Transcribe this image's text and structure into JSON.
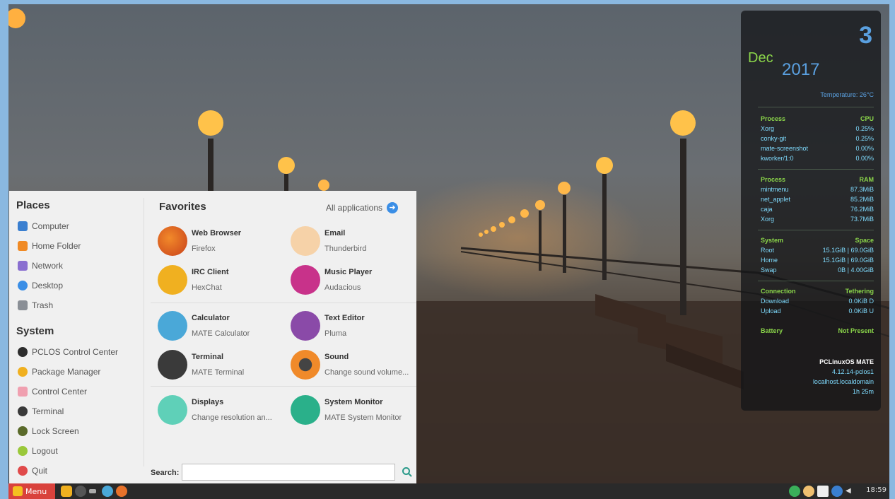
{
  "conky": {
    "day": "3",
    "month": "Dec",
    "year": "2017",
    "temperature": "Temperature: 26°C",
    "cpu": {
      "header_left": "Process",
      "header_right": "CPU",
      "rows": [
        {
          "name": "Xorg",
          "value": "0.25%"
        },
        {
          "name": "conky-git",
          "value": "0.25%"
        },
        {
          "name": "mate-screenshot",
          "value": "0.00%"
        },
        {
          "name": "kworker/1:0",
          "value": "0.00%"
        }
      ]
    },
    "ram": {
      "header_left": "Process",
      "header_right": "RAM",
      "rows": [
        {
          "name": "mintmenu",
          "value": "87.3MiB"
        },
        {
          "name": "net_applet",
          "value": "85.2MiB"
        },
        {
          "name": "caja",
          "value": "76.2MiB"
        },
        {
          "name": "Xorg",
          "value": "73.7MiB"
        }
      ]
    },
    "space": {
      "header_left": "System",
      "header_right": "Space",
      "rows": [
        {
          "name": "Root",
          "value": "15.1GiB | 69.0GiB"
        },
        {
          "name": "Home",
          "value": "15.1GiB | 69.0GiB"
        },
        {
          "name": "Swap",
          "value": "0B | 4.00GiB"
        }
      ]
    },
    "net": {
      "header_left": "Connection",
      "header_right": "Tethering",
      "rows": [
        {
          "name": "Download",
          "value": "0.0KiB D"
        },
        {
          "name": "Upload",
          "value": "0.0KiB U"
        }
      ]
    },
    "battery": {
      "label": "Battery",
      "value": "Not Present"
    },
    "system": {
      "os": "PCLinuxOS MATE",
      "kernel": "4.12.14-pclos1",
      "host": "localhost.localdomain",
      "uptime": "1h 25m"
    }
  },
  "menu": {
    "places_title": "Places",
    "places": [
      "Computer",
      "Home Folder",
      "Network",
      "Desktop",
      "Trash"
    ],
    "system_title": "System",
    "system": [
      "PCLOS Control Center",
      "Package Manager",
      "Control Center",
      "Terminal",
      "Lock Screen",
      "Logout",
      "Quit"
    ],
    "favorites_title": "Favorites",
    "all_applications": "All applications",
    "apps": [
      {
        "name": "Web Browser",
        "desc": "Firefox"
      },
      {
        "name": "Email",
        "desc": "Thunderbird"
      },
      {
        "name": "IRC Client",
        "desc": "HexChat"
      },
      {
        "name": "Music Player",
        "desc": "Audacious"
      },
      {
        "name": "Calculator",
        "desc": "MATE Calculator"
      },
      {
        "name": "Text Editor",
        "desc": "Pluma"
      },
      {
        "name": "Terminal",
        "desc": "MATE Terminal"
      },
      {
        "name": "Sound",
        "desc": "Change sound volume..."
      },
      {
        "name": "Displays",
        "desc": "Change resolution an..."
      },
      {
        "name": "System Monitor",
        "desc": "MATE System Monitor"
      }
    ],
    "search_label": "Search:",
    "search_value": ""
  },
  "taskbar": {
    "menu_label": "Menu",
    "clock": "18:59"
  },
  "colors": {
    "menu_button": "#d9423c",
    "conky_green": "#8bd64a",
    "conky_blue": "#5aa0e0",
    "accent_blue": "#3a8ee6"
  }
}
